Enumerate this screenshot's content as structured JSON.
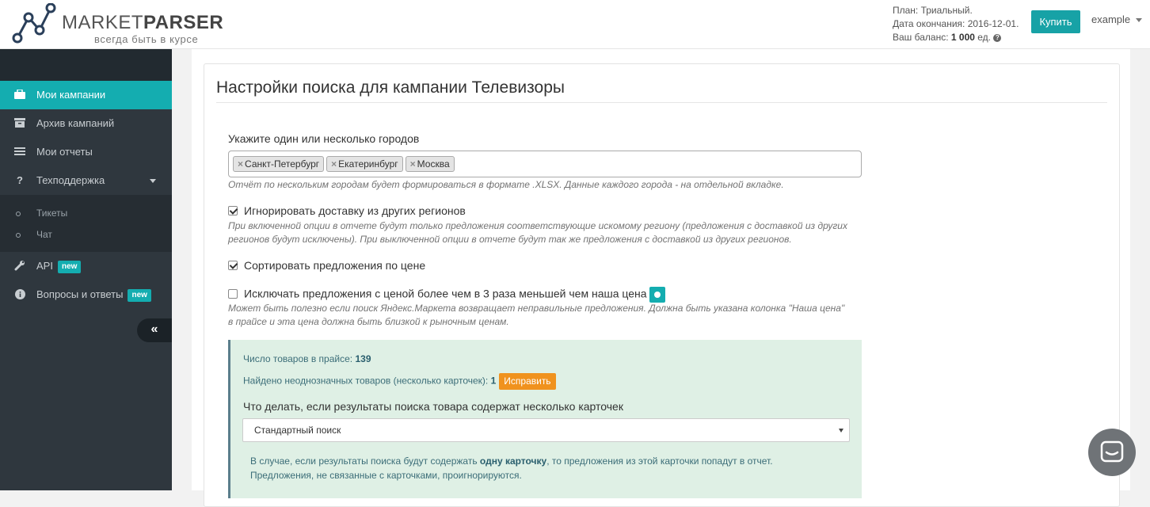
{
  "header": {
    "logo_brand_light": "MARKET",
    "logo_brand_bold": "PARSER",
    "logo_slogan": "всегда быть в курсе",
    "plan_line": "План: Триальный.",
    "expiry_line": "Дата окончания: 2016-12-01.",
    "balance_label": "Ваш баланс:",
    "balance_value": "1 000",
    "balance_unit": "ед.",
    "help_icon": "question-circle-icon",
    "buy_label": "Купить",
    "user_name": "example",
    "accent": "#17a2a6"
  },
  "sidebar": {
    "items": [
      {
        "label": "Мои кампании",
        "icon": "briefcase-icon",
        "active": true
      },
      {
        "label": "Архив кампаний",
        "icon": "archive-icon"
      },
      {
        "label": "Мои отчеты",
        "icon": "list-icon"
      },
      {
        "label": "Техподдержка",
        "icon": "question-icon",
        "expanded": true
      }
    ],
    "sub_items": [
      {
        "label": "Тикеты"
      },
      {
        "label": "Чат"
      }
    ],
    "items_after": [
      {
        "label": "API",
        "icon": "wrench-icon",
        "badge": "new"
      },
      {
        "label": "Вопросы и ответы",
        "icon": "info-icon",
        "badge": "new"
      }
    ],
    "collapse_glyph": "«"
  },
  "main": {
    "title": "Настройки поиска для кампании Телевизоры",
    "cities_label": "Укажите один или несколько городов",
    "cities": [
      "Санкт-Петербург",
      "Екатеринбург",
      "Москва"
    ],
    "tag_remove_glyph": "×",
    "cities_hint": "Отчёт по нескольким городам будет формироваться в формате .XLSX. Данные каждого города - на отдельной вкладке.",
    "opt_ignore_delivery": {
      "label": "Игнорировать доставку из других регионов",
      "checked": true,
      "hint_1": "При включенной опции в отчете будут только предложения соответствующие искомому региону (предложения с доставкой из других",
      "hint_2": "регионов будут исключены). При выключенной опции в отчете будут так же предложения с доставкой из других регионов."
    },
    "opt_sort_price": {
      "label": "Сортировать предложения по цене",
      "checked": true
    },
    "opt_exclude_cheap": {
      "label": "Исключать предложения с ценой более чем в 3 раза меньшей чем наша цена",
      "checked": false,
      "hint_1": "Может быть полезно если поиск Яндекс.Маркета возвращает неправильные предложения. Должна быть указана колонка \"Наша цена\"",
      "hint_2": "в прайсе и эта цена должна быть близкой к рыночным ценам."
    },
    "stats": {
      "products_label": "Число товаров в прайсе:",
      "products_value": "139",
      "ambiguous_label": "Найдено неоднозначных товаров (несколько карточек):",
      "ambiguous_value": "1",
      "fix_label": "Исправить",
      "multi_label": "Что делать, если результаты поиска товара содержат несколько карточек",
      "select_value": "Стандартный поиск",
      "note_part1": "В случае, если результаты поиска будут содержать ",
      "note_bold": "одну карточку",
      "note_part2": ", то предложения из этой карточки попадут в отчет.",
      "note_line2": "Предложения, не связанные с карточками, проигнорируются."
    }
  }
}
